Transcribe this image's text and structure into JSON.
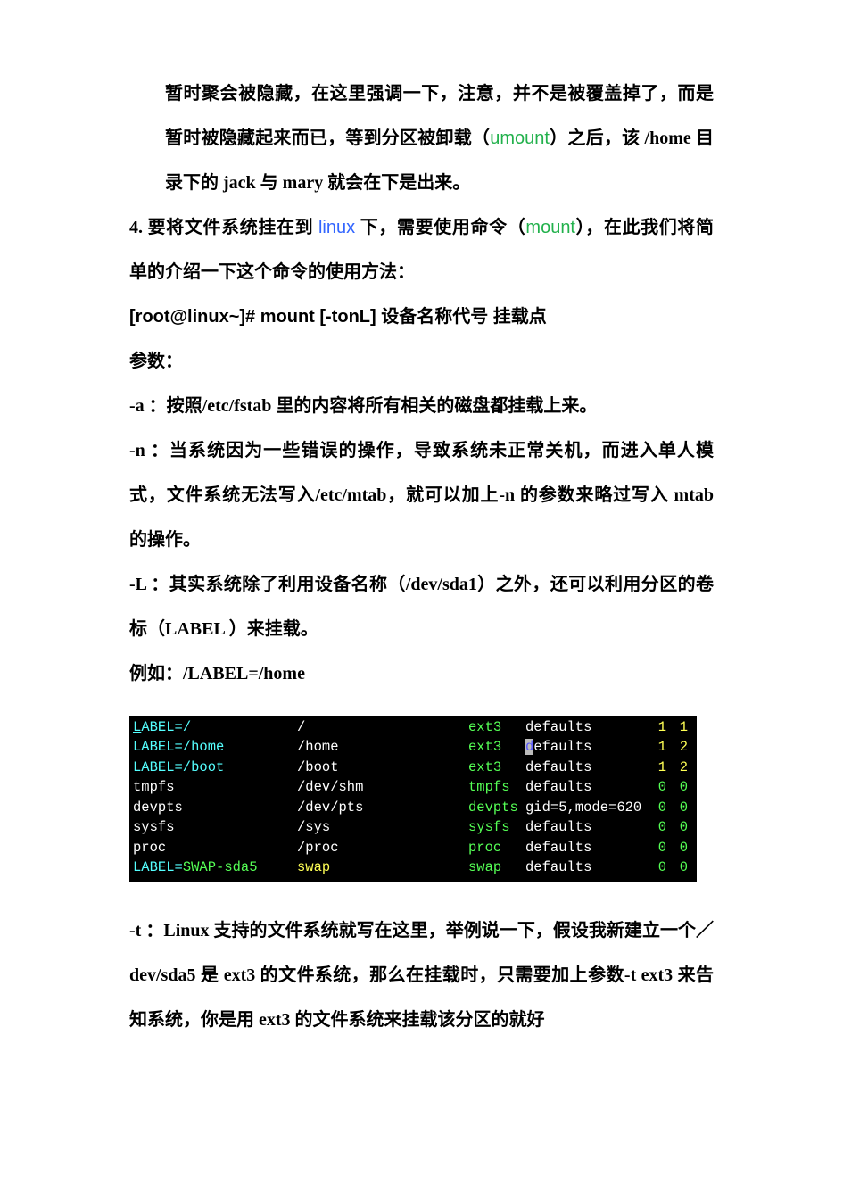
{
  "p3": {
    "t1": "暂时聚会被隐藏，在这里强调一下，注意，并不是被覆盖掉了，而是暂时被隐藏起来而已，等到分区被卸载（",
    "umount": "umount",
    "t2": "）之后，该 /home 目录下的 jack 与 mary 就会在下是出来。"
  },
  "p4": {
    "num": "4. ",
    "t1": "要将文件系统挂在到 ",
    "linux": "linux",
    "t2": " 下，需要使用命令（",
    "mount": "mount",
    "t3": "），在此我们将简单的介绍一下这个命令的使用方法："
  },
  "cmd": "[root@linux~]# mount [-tonL] 设备名称代号  挂载点",
  "params_label": "参数：",
  "opt_a": "-a ：按照/etc/fstab 里的内容将所有相关的磁盘都挂载上来。",
  "opt_n": "-n ：当系统因为一些错误的操作，导致系统未正常关机，而进入单人模式，文件系统无法写入/etc/mtab，就可以加上-n 的参数来略过写入 mtab 的操作。",
  "opt_L": "-L ：其实系统除了利用设备名称（/dev/sda1）之外，还可以利用分区的卷标（LABEL ）来挂载。",
  "label_example": "例如：/LABEL=/home",
  "fstab": [
    {
      "fs_pre": "",
      "fs_ul": "L",
      "fs_post": "ABEL=/",
      "fs_extra_color": "cyan",
      "fs_extra": "",
      "mnt": "/",
      "type": "ext3",
      "type_color": "lime",
      "opt": "defaults",
      "opt_pre": "",
      "opt_hl": "",
      "dump": "1",
      "pass": "1",
      "num_color": "yel"
    },
    {
      "fs_pre": "",
      "fs_ul": "",
      "fs_post": "LABEL=/home",
      "fs_extra_color": "",
      "mnt": "/home",
      "type": "ext3",
      "type_color": "lime",
      "opt": "efaults",
      "opt_pre": "",
      "opt_hl": "d",
      "dump": "1",
      "pass": "2",
      "num_color": "yel"
    },
    {
      "fs_pre": "",
      "fs_ul": "",
      "fs_post": "LABEL=/boot",
      "fs_extra_color": "",
      "mnt": "/boot",
      "type": "ext3",
      "type_color": "lime",
      "opt": "defaults",
      "opt_pre": "",
      "opt_hl": "",
      "dump": "1",
      "pass": "2",
      "num_color": "yel"
    },
    {
      "fs_pre": "",
      "fs_ul": "",
      "fs_post": "tmpfs",
      "fs_color": "white",
      "mnt": "/dev/shm",
      "type": "tmpfs",
      "type_color": "lime",
      "opt": "defaults",
      "opt_pre": "",
      "opt_hl": "",
      "dump": "0",
      "pass": "0",
      "num_color": "lime"
    },
    {
      "fs_pre": "",
      "fs_ul": "",
      "fs_post": "devpts",
      "fs_color": "white",
      "mnt": "/dev/pts",
      "type": "devpts",
      "type_color": "lime",
      "opt": "gid=5,mode=620",
      "opt_pre": "",
      "opt_hl": "",
      "dump": "0",
      "pass": "0",
      "num_color": "lime"
    },
    {
      "fs_pre": "",
      "fs_ul": "",
      "fs_post": "sysfs",
      "fs_color": "white",
      "mnt": "/sys",
      "type": "sysfs",
      "type_color": "lime",
      "opt": "defaults",
      "opt_pre": "",
      "opt_hl": "",
      "dump": "0",
      "pass": "0",
      "num_color": "lime"
    },
    {
      "fs_pre": "",
      "fs_ul": "",
      "fs_post": "proc",
      "fs_color": "white",
      "mnt": "/proc",
      "type": "proc",
      "type_color": "lime",
      "opt": "defaults",
      "opt_pre": "",
      "opt_hl": "",
      "dump": "0",
      "pass": "0",
      "num_color": "lime"
    },
    {
      "fs_pre": "LABEL=",
      "fs_ul": "",
      "fs_post": "",
      "fs_color": "cyan",
      "fs_extra": "SWAP-sda5",
      "fs_extra_color": "lime",
      "mnt": "swap",
      "mnt_color": "yel",
      "type": "swap",
      "type_color": "lime",
      "opt": "defaults",
      "opt_pre": "",
      "opt_hl": "",
      "dump": "0",
      "pass": "0",
      "num_color": "lime"
    }
  ],
  "opt_t": "-t ：Linux 支持的文件系统就写在这里，举例说一下，假设我新建立一个／dev/sda5 是 ext3 的文件系统，那么在挂载时，只需要加上参数-t ext3 来告知系统，你是用 ext3 的文件系统来挂载该分区的就好"
}
